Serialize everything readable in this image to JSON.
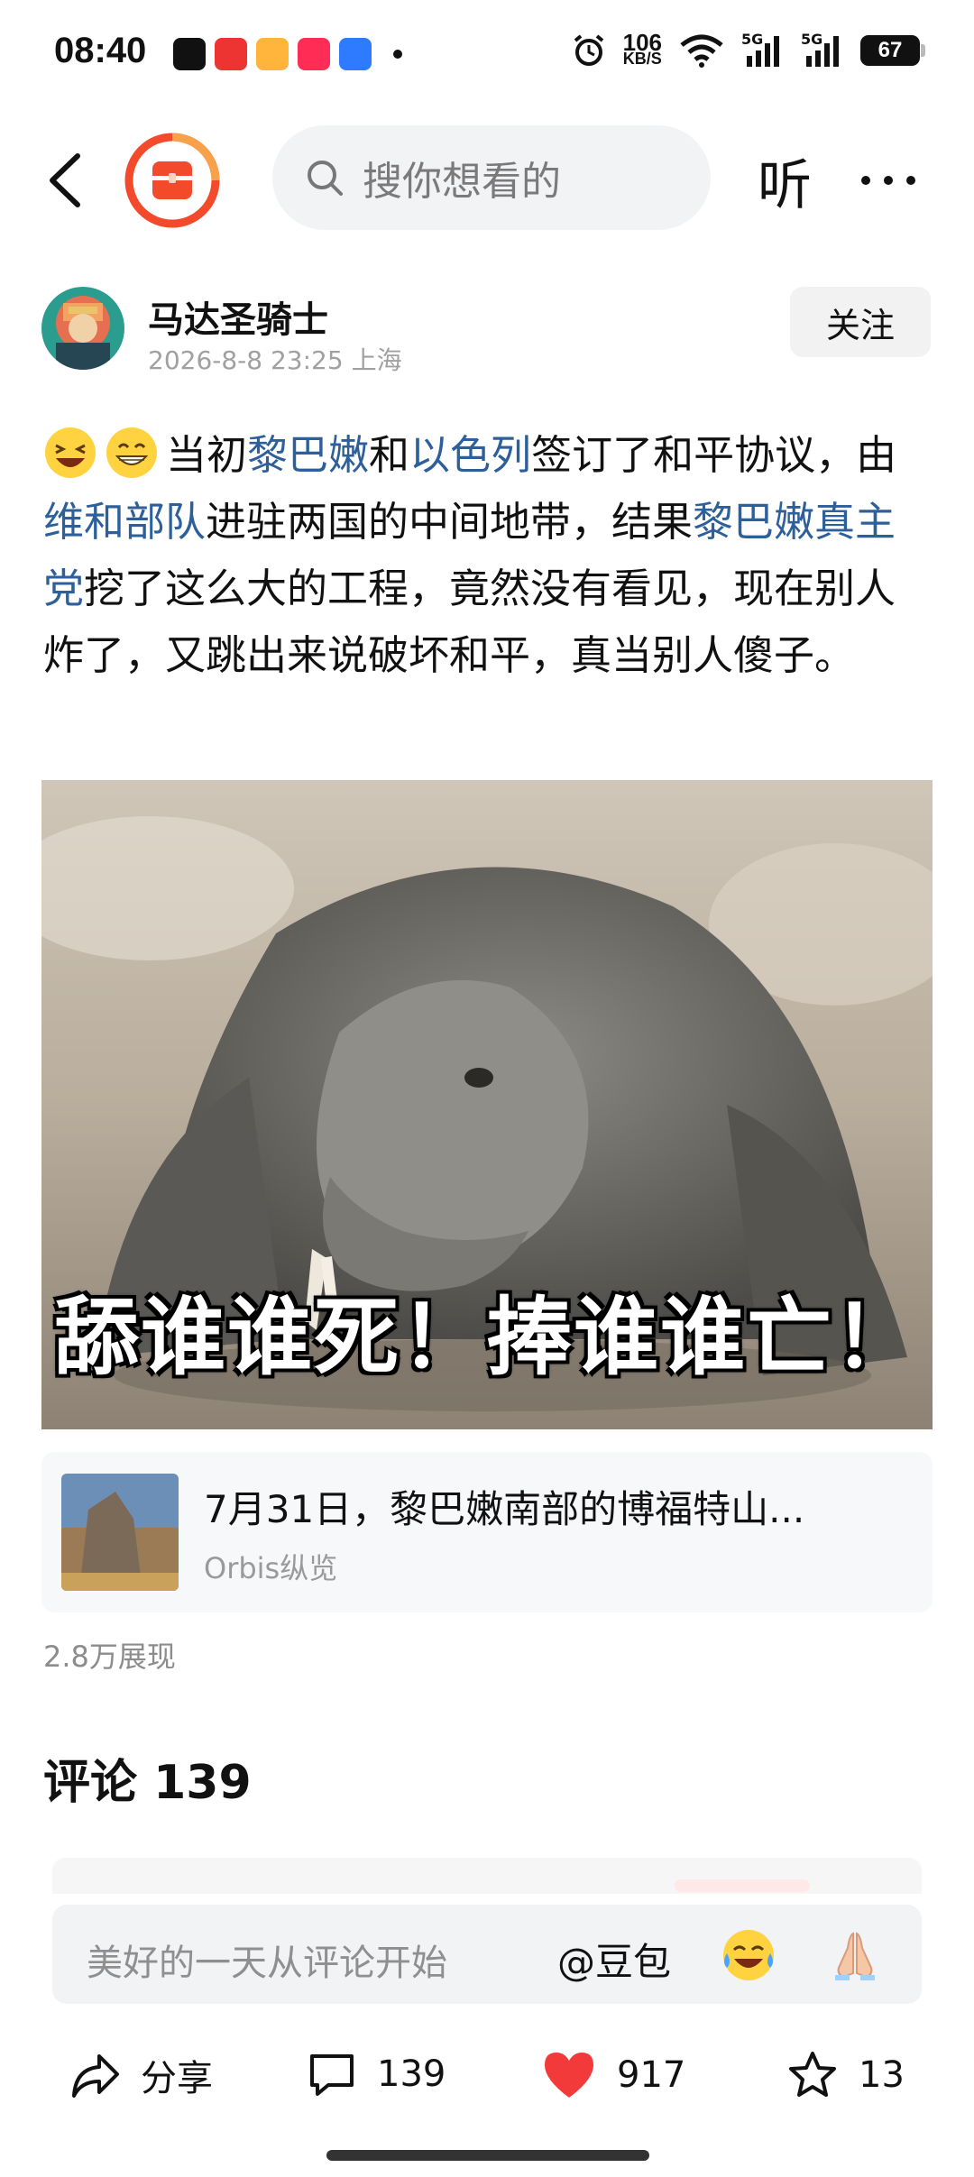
{
  "status_bar": {
    "time": "08:40",
    "net_speed_value": "106",
    "net_speed_unit": "KB/S",
    "signal_1_label": "5G",
    "signal_2_label": "5G",
    "battery": "67"
  },
  "nav": {
    "search_placeholder": "搜你想看的",
    "listen_label": "听"
  },
  "author": {
    "name": "马达圣骑士",
    "meta": "2026-8-8 23:25 上海",
    "follow_label": "关注"
  },
  "post": {
    "t1": "当初",
    "l1": "黎巴嫩",
    "t2": "和",
    "l2": "以色列",
    "t3": "签订了和平协议，由",
    "l3": "维和部队",
    "t4": "进驻两国的中间地带，结果",
    "l4": "黎巴嫩真主党",
    "t5": "挖了这么大的工程，竟然没有看见，现在别人炸了，又跳出来说破坏和平，真当别人傻子。"
  },
  "image": {
    "caption": "舔谁谁死！捧谁谁亡！"
  },
  "linked_article": {
    "title": "7月31日，黎巴嫩南部的博福特山...",
    "source": "Orbis纵览"
  },
  "views": "2.8万展现",
  "comments": {
    "heading": "评论 139"
  },
  "comment_input": {
    "placeholder": "美好的一天从评论开始",
    "mention_label": "@豆包"
  },
  "bottom_bar": {
    "share_label": "分享",
    "comment_count": "139",
    "like_count": "917",
    "favorite_count": "13"
  },
  "colors": {
    "link": "#2d5f9a",
    "like_red": "#f23a3a",
    "brand_orange": "#f24a2b"
  }
}
